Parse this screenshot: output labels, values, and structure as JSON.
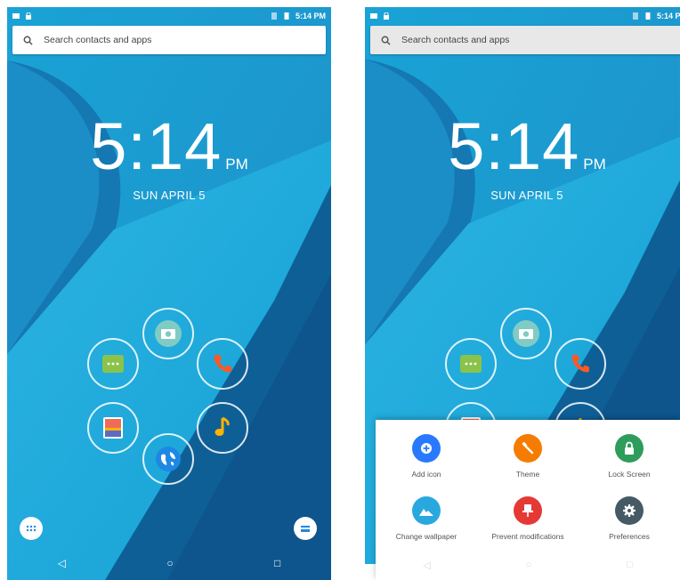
{
  "status": {
    "time": "5:14 PM"
  },
  "search": {
    "label": "Search contacts and apps"
  },
  "clock": {
    "time": "5:14",
    "ampm": "PM",
    "date": "SUN APRIL 5"
  },
  "apps": [
    {
      "icon": "camera-icon",
      "color": "#80cbc4"
    },
    {
      "icon": "messages-icon",
      "color": "#8bc34a"
    },
    {
      "icon": "phone-icon",
      "color": "#ff5722"
    },
    {
      "icon": "gallery-icon",
      "color": "#ffb300"
    },
    {
      "icon": "music-icon",
      "color": "#ffb300"
    },
    {
      "icon": "browser-icon",
      "color": "#1e88e5"
    }
  ],
  "dock": {
    "left_icon": "app-drawer-icon",
    "right_icon": "recents-drawer-icon"
  },
  "nav": {
    "back": "◁",
    "home": "○",
    "recents": "□"
  },
  "menu": {
    "items": [
      {
        "label": "Add icon",
        "icon": "add-icon",
        "color": "#2979ff"
      },
      {
        "label": "Theme",
        "icon": "theme-icon",
        "color": "#f57c00"
      },
      {
        "label": "Lock Screen",
        "icon": "lock-icon",
        "color": "#2e9d5b"
      },
      {
        "label": "Change wallpaper",
        "icon": "wallpaper-icon",
        "color": "#29a8e0"
      },
      {
        "label": "Prevent modifications",
        "icon": "pin-icon",
        "color": "#e53935"
      },
      {
        "label": "Preferences",
        "icon": "gear-icon",
        "color": "#455a64"
      }
    ]
  }
}
